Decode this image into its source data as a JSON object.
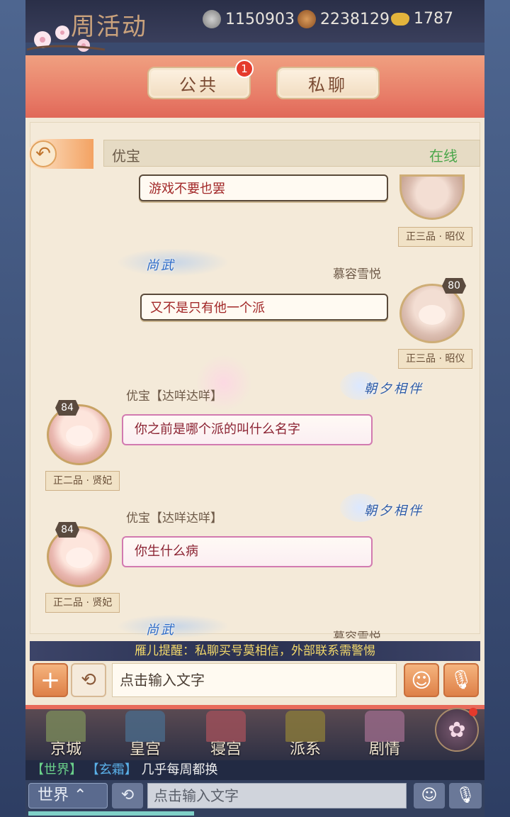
{
  "topbar": {
    "event_title": "周活动",
    "resources": [
      {
        "icon": "silver-coin-icon",
        "value": "1150903"
      },
      {
        "icon": "copper-coin-icon",
        "value": "2238129"
      },
      {
        "icon": "gold-ingot-icon",
        "value": "1787"
      }
    ]
  },
  "tabs": {
    "public_label": "公共",
    "public_badge": "1",
    "private_label": "私聊"
  },
  "chat_header": {
    "name": "优宝",
    "status": "在线"
  },
  "messages": [
    {
      "side": "right",
      "text": "游戏不要也罢",
      "rank": "正三品 · 昭仪"
    },
    {
      "side": "right",
      "sender": "慕容雪悦",
      "tag": "尚武",
      "level": "80",
      "text": "又不是只有他一个派",
      "rank": "正三品 · 昭仪"
    },
    {
      "side": "left",
      "sender": "优宝【达咩达咩】",
      "tag": "朝夕相伴",
      "level": "84",
      "text": "你之前是哪个派的叫什么名字",
      "rank": "正二品 · 贤妃"
    },
    {
      "side": "left",
      "sender": "优宝【达咩达咩】",
      "tag": "朝夕相伴",
      "level": "84",
      "text": "你生什么病",
      "rank": "正二品 · 贤妃"
    },
    {
      "side": "right",
      "sender": "慕容雪悦",
      "tag": "尚武"
    }
  ],
  "notice": "雁儿提醒：私聊买号莫相信，外部联系需警惕",
  "input": {
    "placeholder": "点击输入文字"
  },
  "nav": [
    {
      "label": "京城"
    },
    {
      "label": "皇宫"
    },
    {
      "label": "寝宫"
    },
    {
      "label": "派系"
    },
    {
      "label": "剧情"
    }
  ],
  "ticker": {
    "channel": "【世界】",
    "sender": "【玄霜】",
    "message": "几乎每周都换"
  },
  "world_bar": {
    "channel_label": "世界",
    "placeholder": "点击输入文字"
  },
  "colors": {
    "accent": "#e77a66",
    "online": "#4aa64a",
    "notice_text": "#f3d96b",
    "right_bubble_text": "#a22828",
    "left_bubble_border": "#d27ab0"
  }
}
